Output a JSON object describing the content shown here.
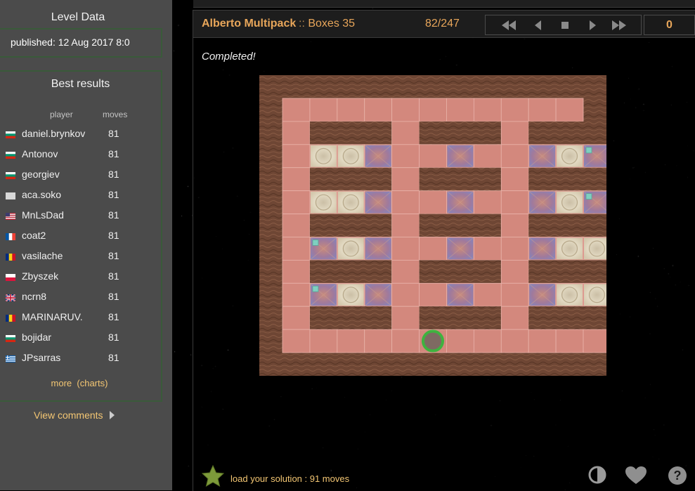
{
  "sidebar": {
    "level_data_title": "Level Data",
    "published": "published: 12 Aug 2017 8:0",
    "best_results_title": "Best results",
    "col_player": "player",
    "col_moves": "moves",
    "results": [
      {
        "player": "daniel.brynkov",
        "moves": "81",
        "flag": "bg"
      },
      {
        "player": "Antonov",
        "moves": "81",
        "flag": "bg"
      },
      {
        "player": "georgiev",
        "moves": "81",
        "flag": "bg"
      },
      {
        "player": "aca.soko",
        "moves": "81",
        "flag": "none"
      },
      {
        "player": "MnLsDad",
        "moves": "81",
        "flag": "us"
      },
      {
        "player": "coat2",
        "moves": "81",
        "flag": "fr"
      },
      {
        "player": "vasilache",
        "moves": "81",
        "flag": "ro"
      },
      {
        "player": "Zbyszek",
        "moves": "81",
        "flag": "pl"
      },
      {
        "player": "ncrn8",
        "moves": "81",
        "flag": "gb"
      },
      {
        "player": "MARINARUV.",
        "moves": "81",
        "flag": "ro"
      },
      {
        "player": "bojidar",
        "moves": "81",
        "flag": "bg"
      },
      {
        "player": "JPsarras",
        "moves": "81",
        "flag": "gr"
      }
    ],
    "more_label": "more",
    "charts_label": "(charts)",
    "view_comments": "View comments"
  },
  "header": {
    "pack_name": "Alberto Multipack",
    "separator": "::",
    "level_name": "Boxes 35",
    "counter": "82/247",
    "move_count": "0"
  },
  "status": "Completed!",
  "footer": {
    "load_solution": "load your solution : 91 moves"
  },
  "icons": {
    "star": "star-icon",
    "contrast": "contrast-icon",
    "heart": "heart-icon",
    "help": "help-icon"
  },
  "board": {
    "rows": [
      "#############",
      "#...........#",
      "#.WWW.WWW.WWW#",
      "#.ggb..b..bgX#",
      "#.WWW.WWW.WWW#",
      "#.ggb..b..bgX#",
      "#.WWW.WWW.WWW#",
      "#.Xgb..b..bgg#",
      "#.WWW.WWW.WWW#",
      "#.Xgb..b..bgg#",
      "#.WWW.WWW.WWW#",
      "#.....@......#",
      "#############"
    ],
    "legend": {
      "#": "wall",
      ".": "floor",
      "W": "wall",
      "g": "goal",
      "b": "box-on-goal",
      "X": "box-on-goal-marked",
      "@": "player"
    }
  },
  "colors": {
    "floor": "#d3887d",
    "wall": "#6e4634",
    "goal": "#dcd2b9",
    "box": "#9c8fb8",
    "player": "#3fb23f",
    "accent": "#e8a65a",
    "sidebar": "#4b4b4b"
  }
}
